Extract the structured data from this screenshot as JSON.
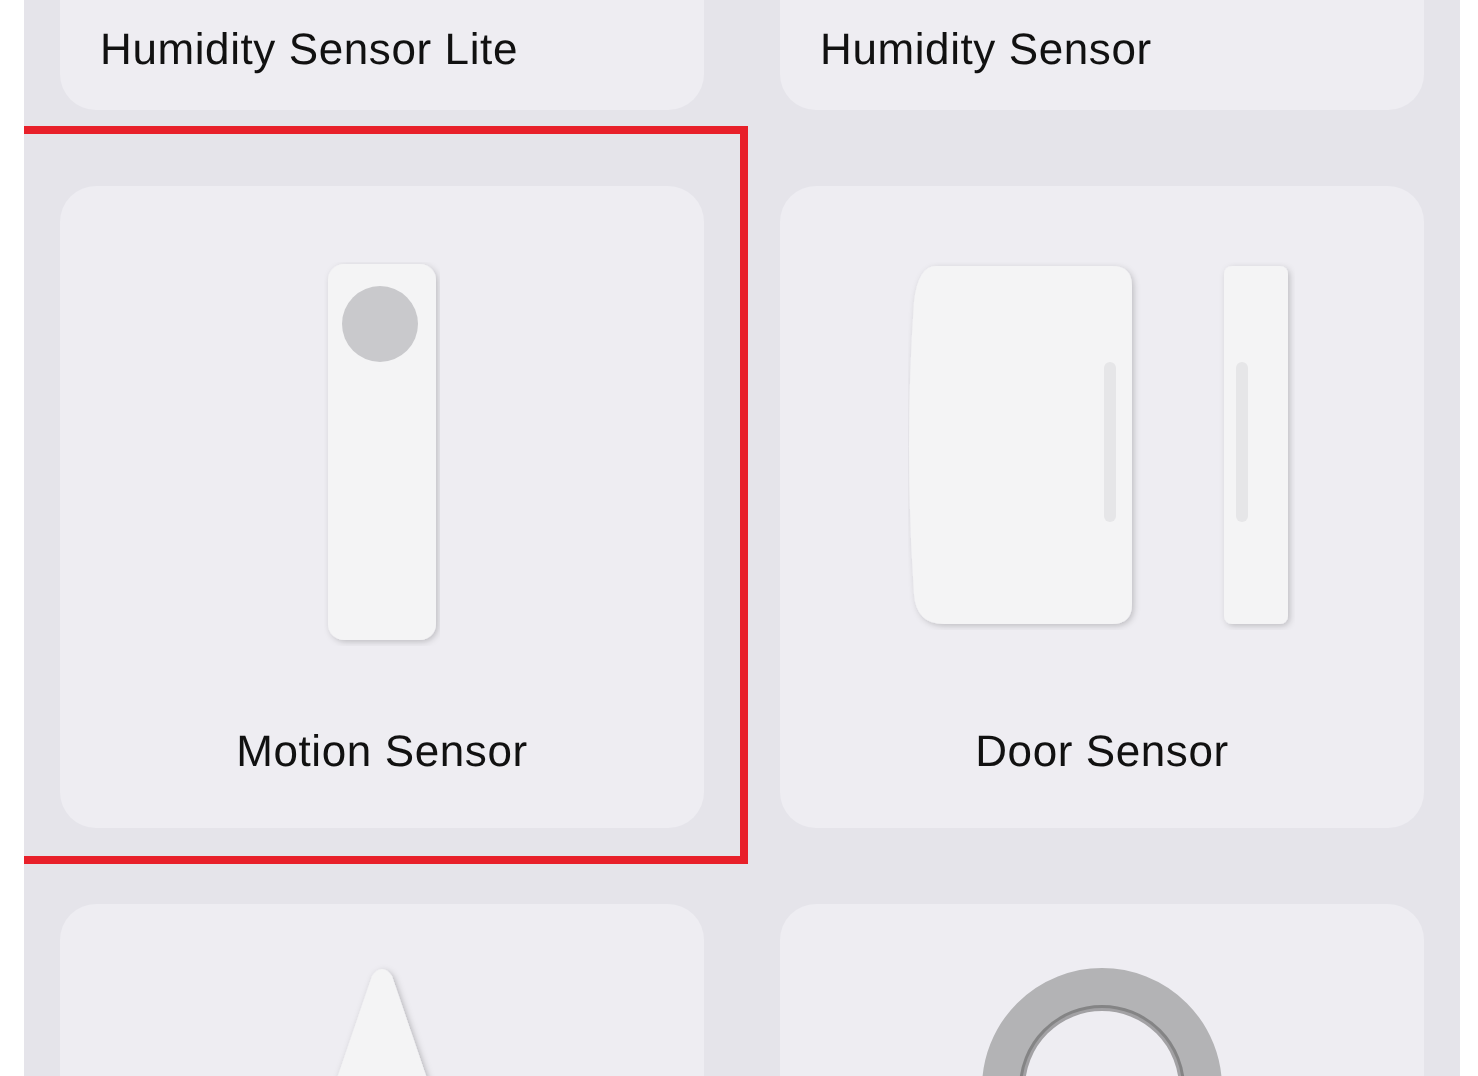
{
  "devices": [
    {
      "label": "Humidity Sensor Lite",
      "kind": "cut",
      "highlighted": false
    },
    {
      "label": "Humidity Sensor",
      "kind": "cut",
      "highlighted": false
    },
    {
      "label": "Motion Sensor",
      "kind": "motion",
      "highlighted": true
    },
    {
      "label": "Door Sensor",
      "kind": "door",
      "highlighted": false
    },
    {
      "kind": "triangle",
      "highlighted": false
    },
    {
      "kind": "ring",
      "highlighted": false
    }
  ]
}
